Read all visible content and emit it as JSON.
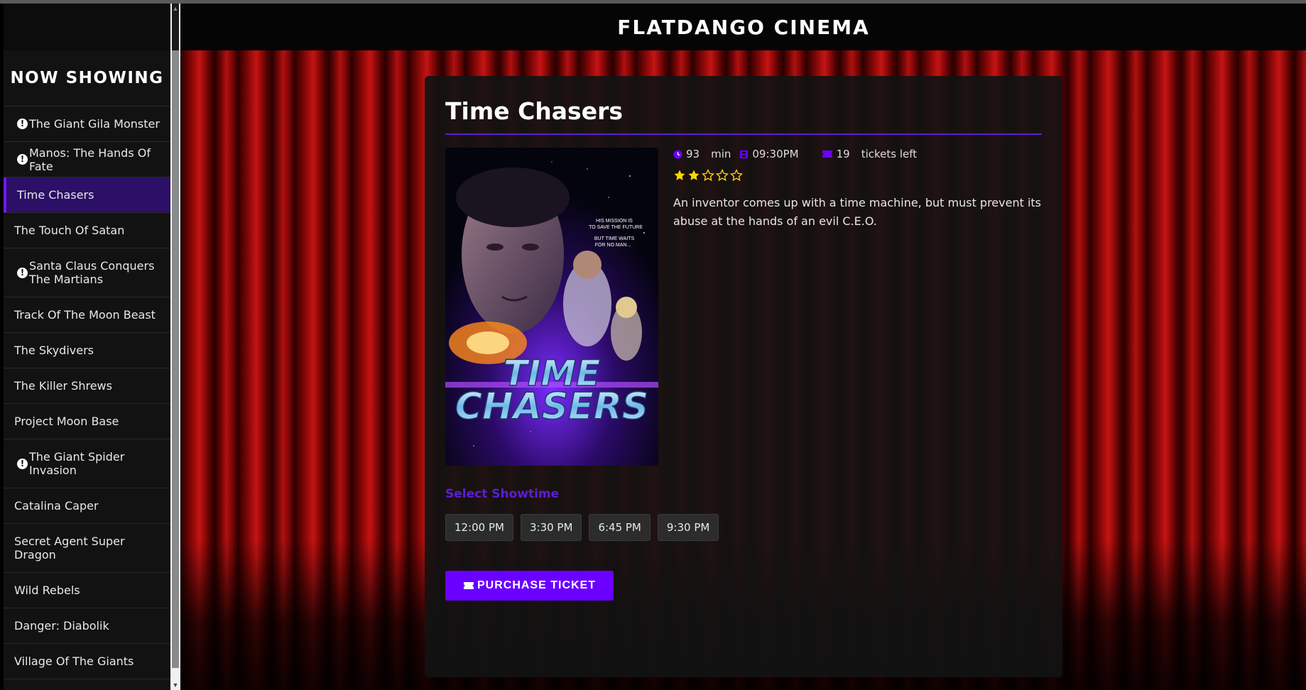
{
  "app": {
    "title": "FLATDANGO CINEMA"
  },
  "sidebar": {
    "heading": "NOW SHOWING",
    "items": [
      {
        "label": "The Giant Gila Monster",
        "alert": true,
        "active": false
      },
      {
        "label": "Manos: The Hands Of Fate",
        "alert": true,
        "active": false
      },
      {
        "label": "Time Chasers",
        "alert": false,
        "active": true
      },
      {
        "label": "The Touch Of Satan",
        "alert": false,
        "active": false
      },
      {
        "label": "Santa Claus Conquers The Martians",
        "alert": true,
        "active": false
      },
      {
        "label": "Track Of The Moon Beast",
        "alert": false,
        "active": false
      },
      {
        "label": "The Skydivers",
        "alert": false,
        "active": false
      },
      {
        "label": "The Killer Shrews",
        "alert": false,
        "active": false
      },
      {
        "label": "Project Moon Base",
        "alert": false,
        "active": false
      },
      {
        "label": "The Giant Spider Invasion",
        "alert": true,
        "active": false
      },
      {
        "label": "Catalina Caper",
        "alert": false,
        "active": false
      },
      {
        "label": "Secret Agent Super Dragon",
        "alert": false,
        "active": false
      },
      {
        "label": "Wild Rebels",
        "alert": false,
        "active": false
      },
      {
        "label": "Danger: Diabolik",
        "alert": false,
        "active": false
      },
      {
        "label": "Village Of The Giants",
        "alert": false,
        "active": false
      }
    ]
  },
  "movie": {
    "title": "Time Chasers",
    "runtime_value": "93",
    "runtime_unit": "min",
    "showtime": "09:30PM",
    "tickets_value": "19",
    "tickets_label": "tickets left",
    "rating": 2,
    "rating_max": 5,
    "description": "An inventor comes up with a time machine, but must prevent its abuse at the hands of an evil C.E.O.",
    "poster": {
      "tagline_1": "HIS MISSION IS",
      "tagline_2": "TO SAVE THE FUTURE",
      "tagline_3": "BUT TIME WAITS",
      "tagline_4": "FOR NO MAN...",
      "logo_line_1": "TIME",
      "logo_line_2": "CHASERS"
    }
  },
  "showtimes": {
    "heading": "Select Showtime",
    "options": [
      "12:00 PM",
      "3:30 PM",
      "6:45 PM",
      "9:30 PM"
    ]
  },
  "purchase": {
    "label": "PURCHASE TICKET"
  },
  "colors": {
    "accent": "#6a00ff",
    "accent_text": "#5b1ed6",
    "active_bg": "#2c0f66",
    "star": "#ffd700"
  },
  "icons": {
    "alert": "alert-circle-icon",
    "clock": "clock-icon",
    "film": "film-icon",
    "ticket": "ticket-icon",
    "star": "star-icon"
  }
}
